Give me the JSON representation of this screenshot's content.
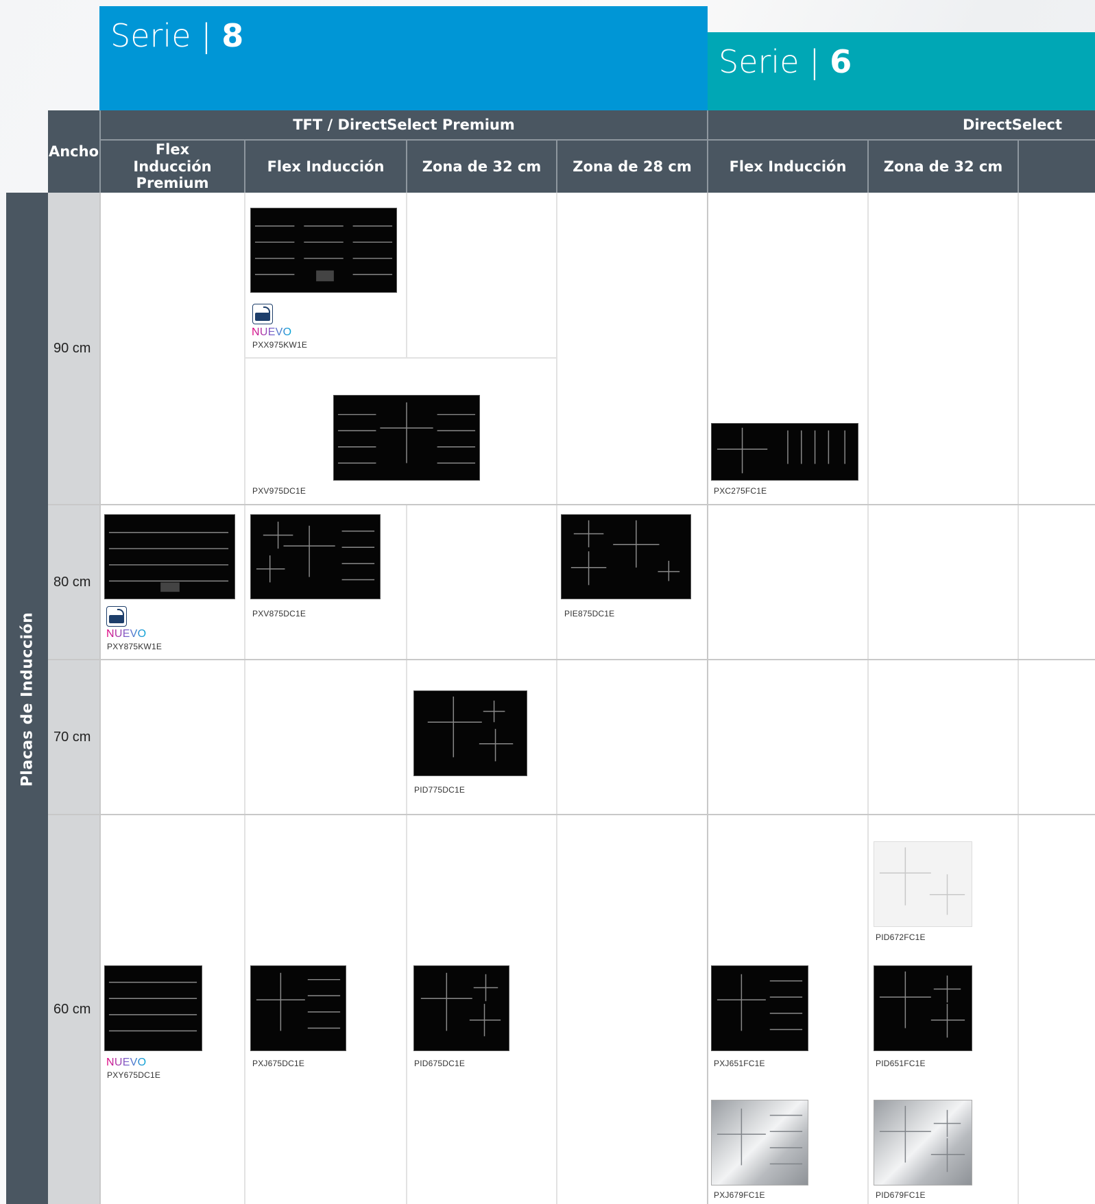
{
  "series": {
    "serie8": {
      "word": "Serie",
      "separator": "|",
      "number": "8"
    },
    "serie6": {
      "word": "Serie",
      "separator": "|",
      "number": "6"
    }
  },
  "header": {
    "ancho": "Ancho",
    "group_tft": "TFT / DirectSelect Premium",
    "group_direct": "DirectSelect",
    "columns": [
      "Flex Inducción Premium",
      "Flex Inducción",
      "Zona de 32 cm",
      "Zona de 28 cm",
      "Flex Inducción",
      "Zona de 32 cm",
      ""
    ]
  },
  "side_label": "Placas de Inducción",
  "rows": [
    "90 cm",
    "80 cm",
    "70 cm",
    "60 cm"
  ],
  "products": {
    "pxx975kw1e": {
      "model": "PXX975KW1E",
      "badge": "NUEVO",
      "home_connect": true
    },
    "pxv975dc1e": {
      "model": "PXV975DC1E"
    },
    "pxc275fc1e": {
      "model": "PXC275FC1E"
    },
    "pxy875kw1e": {
      "model": "PXY875KW1E",
      "badge": "NUEVO",
      "home_connect": true
    },
    "pxv875dc1e": {
      "model": "PXV875DC1E"
    },
    "pie875dc1e": {
      "model": "PIE875DC1E"
    },
    "pid775dc1e": {
      "model": "PID775DC1E"
    },
    "pxy675dc1e": {
      "model": "PXY675DC1E",
      "badge": "NUEVO"
    },
    "pxj675dc1e": {
      "model": "PXJ675DC1E"
    },
    "pid675dc1e": {
      "model": "PID675DC1E"
    },
    "pxj651fc1e": {
      "model": "PXJ651FC1E"
    },
    "pid651fc1e": {
      "model": "PID651FC1E"
    },
    "pid672fc1e": {
      "model": "PID672FC1E",
      "finish": "white"
    },
    "pxj679fc1e": {
      "model": "PXJ679FC1E",
      "finish": "steel"
    },
    "pid679fc1e": {
      "model": "PID679FC1E",
      "finish": "steel"
    }
  },
  "colors": {
    "serie8_blue": "#0096d6",
    "serie6_teal": "#00a7b5",
    "header_gray": "#4a5661",
    "row_label_gray": "#d4d6d8",
    "nuevo_gradient": [
      "#e6007e",
      "#7a5ec8",
      "#00a6d6"
    ]
  }
}
